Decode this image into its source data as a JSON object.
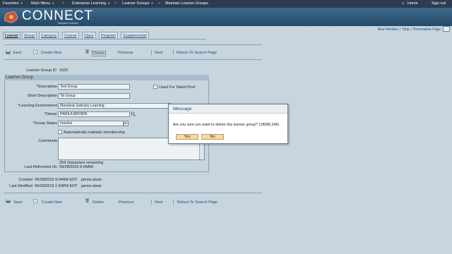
{
  "topnav": {
    "favorites": "Favorites",
    "main_menu": "Main Menu",
    "crumb1": "Enterprise Learning",
    "crumb2": "Learner Groups",
    "crumb3": "Maintain Learner Groups",
    "home": "Home",
    "signout": "Sign out"
  },
  "brand": {
    "name": "CONNECT",
    "sub": "Maryland Judiciary"
  },
  "pagelinks": {
    "new_window": "New Window",
    "help": "Help",
    "personalize": "Personalize Page"
  },
  "tabs": [
    {
      "label": "Learner"
    },
    {
      "label": "Group"
    },
    {
      "label": "Category"
    },
    {
      "label": "Course"
    },
    {
      "label": "Class"
    },
    {
      "label": "Program"
    },
    {
      "label": "Supplemental"
    }
  ],
  "toolbar": {
    "save": "Save",
    "create_new": "Create New",
    "delete": "Delete",
    "previous": "Previous",
    "next": "Next",
    "return": "Return To Search Page"
  },
  "form": {
    "learner_group_id_label": "Learner Group ID",
    "learner_group_id": "1020",
    "section_title": "Learner Group",
    "description_label": "*Description",
    "description": "Test Group",
    "short_desc_label": "Short Description",
    "short_desc": "Tst Group",
    "talent_pool_label": "Used For Talent Pool",
    "env_label": "*Learning Environment",
    "env": "Maryland Judiciary Learning",
    "owner_label": "*Owner",
    "owner": "PAMILA BROWN",
    "status_label": "*Group Status",
    "status": "Inactive",
    "auto_label": "Automatically maintain membership",
    "comments_label": "Comments",
    "chars_remaining": "254 characters remaining",
    "last_refreshed_label": "Last Refreshed On",
    "last_refreshed": "09/28/2015  9:04AM"
  },
  "audit": {
    "created_label": "Created",
    "created": "09/28/2015  9:04AM EDT",
    "created_by": "james.davis",
    "modified_label": "Last Modified",
    "modified": "09/28/2015  1:59PM EDT",
    "modified_by": "james.davis"
  },
  "dialog": {
    "title": "Message",
    "message": "Are you sure you want to delete this learner group? (18086,246)",
    "yes": "Yes",
    "no": "No"
  },
  "colors": {
    "nav": "#2b3d4f",
    "banner": "#244a68",
    "page": "#c7d5df",
    "button": "#f5d9a8"
  }
}
